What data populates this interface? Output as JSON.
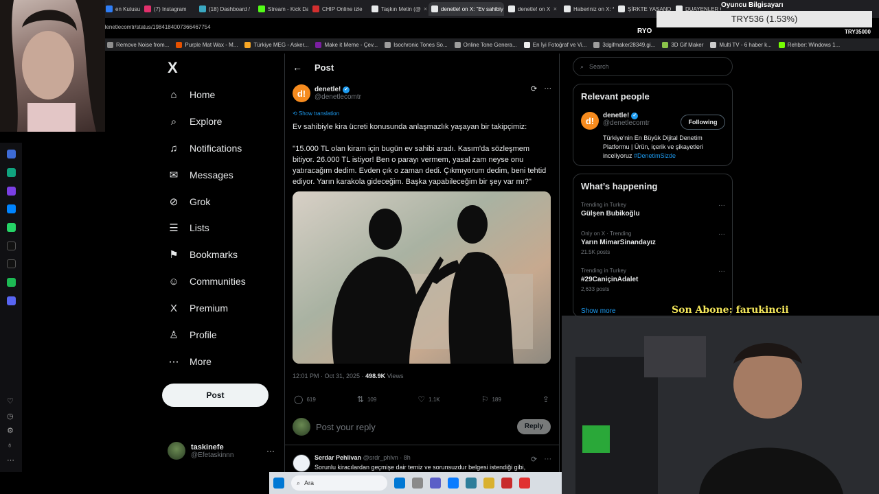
{
  "browser": {
    "tabs": [
      {
        "label": "en Kutusu (51",
        "color": "#2e7df6"
      },
      {
        "label": "(7) Instagram",
        "color": "#e1306c"
      },
      {
        "label": "(18) Dashboard /",
        "color": "#3aa8c1"
      },
      {
        "label": "Stream - Kick Da",
        "color": "#53fc18"
      },
      {
        "label": "CHIP Online izle",
        "color": "#d32f2f"
      },
      {
        "label": "Taşkın Metin (@",
        "color": "#e7e9ea"
      },
      {
        "label": "denetle! on X: \"Ev sahibiy",
        "color": "#e7e9ea"
      },
      {
        "label": "denetle! on X",
        "color": "#e7e9ea"
      },
      {
        "label": "Haberiniz on X: *",
        "color": "#e7e9ea"
      },
      {
        "label": "ŞİRKTE YASANDI",
        "color": "#e7e9ea"
      },
      {
        "label": "DUAYENLER Ca",
        "color": "#e7e9ea"
      }
    ],
    "url": "denetlecomtr/status/1984184007366467754",
    "bookmarks": [
      {
        "label": "Remove Noise from...",
        "color": "#8e8e8e"
      },
      {
        "label": "Purple Mat Wax - M...",
        "color": "#e65100"
      },
      {
        "label": "Türkiye MEG - Asker...",
        "color": "#f9a825"
      },
      {
        "label": "Make it Meme - Çev...",
        "color": "#7b1fa2"
      },
      {
        "label": "Isochronic Tones So...",
        "color": "#9e9e9e"
      },
      {
        "label": "Online Tone Genera...",
        "color": "#9e9e9e"
      },
      {
        "label": "En İyi Fotoğraf ve Vi...",
        "color": "#eeeeee"
      },
      {
        "label": "3dgifmaker28349.gi...",
        "color": "#9e9e9e"
      },
      {
        "label": "3D Gif Maker",
        "color": "#8bc34a"
      },
      {
        "label": "Multi TV - 6 haber k...",
        "color": "#cccccc"
      },
      {
        "label": "Rehber: Windows 1...",
        "color": "#76ff03"
      }
    ]
  },
  "overlay": {
    "ticker": "TRY536 (1.53%)",
    "oyuncu": "Oyuncu Bilgisayarı",
    "ryo": "RYO",
    "try_right": "TRY35000",
    "son_abone": "Son Abone: farukincii"
  },
  "nav": {
    "logo": "X",
    "items": [
      {
        "label": "Home",
        "icon": "⌂"
      },
      {
        "label": "Explore",
        "icon": "⌕"
      },
      {
        "label": "Notifications",
        "icon": "♫"
      },
      {
        "label": "Messages",
        "icon": "✉"
      },
      {
        "label": "Grok",
        "icon": "⊘"
      },
      {
        "label": "Lists",
        "icon": "☰"
      },
      {
        "label": "Bookmarks",
        "icon": "⚑"
      },
      {
        "label": "Communities",
        "icon": "☺"
      },
      {
        "label": "Premium",
        "icon": "X"
      },
      {
        "label": "Profile",
        "icon": "♙"
      },
      {
        "label": "More",
        "icon": "⋯"
      }
    ],
    "post_button": "Post",
    "account": {
      "name": "taskinefe",
      "handle": "@Efetaskinnn"
    }
  },
  "post": {
    "header": "Post",
    "author_name": "denetle!",
    "author_handle": "@denetlecomtr",
    "show_translation": "Show translation",
    "text1": "Ev sahibiyle kira ücreti konusunda anlaşmazlık yaşayan bir takipçimiz:",
    "text2": "''15.000 TL olan kiram için bugün ev sahibi aradı. Kasım'da sözleşmem bitiyor. 26.000 TL istiyor! Ben o parayı vermem, yasal zam neyse onu yatıracağım dedim. Evden çık o zaman dedi. Çıkmıyorum dedim, beni tehtid ediyor. Yarın karakola gideceğim. Başka yapabileceğim bir şey var mı?''",
    "time": "12:01 PM · Oct 31, 2025 · ",
    "views_count": "498.9K",
    "views_label": " Views",
    "replies": "619",
    "reposts": "109",
    "likes": "1.1K",
    "bookmarks": "189",
    "reply_placeholder": "Post your reply",
    "reply_button": "Reply"
  },
  "reply": {
    "name": "Serdar Pehlivan",
    "handle": "@srdr_phlvn · 8h",
    "text": "Sorunlu kiracılardan geçmişe dair temiz ve sorunsuzdur belgesi istendiği gibi,"
  },
  "right": {
    "search_placeholder": "Search",
    "relevant_title": "Relevant people",
    "person_name": "denetle!",
    "person_handle": "@denetlecomtr",
    "follow_label": "Following",
    "bio": "Türkiye'nin En Büyük Dijital Denetim Platformu | Ürün, içerik ve şikayetleri inceliyoruz ",
    "bio_tag": "#DenetimSizde",
    "happening_title": "What’s happening",
    "trends": [
      {
        "context": "Trending in Turkey",
        "title": "Gülşen Bubikoğlu",
        "count": ""
      },
      {
        "context": "Only on X · Trending",
        "title": "Yarın MimarSinandayız",
        "count": "21.5K posts"
      },
      {
        "context": "Trending in Turkey",
        "title": "#29CaniçinAdalet",
        "count": "2,633 posts"
      }
    ],
    "show_more": "Show more"
  },
  "taskbar": {
    "search_label": "Ara",
    "icons": [
      "#0078d4",
      "#8a8a8a",
      "#5b5fc7",
      "#0a7cff",
      "#2d7d9a",
      "#d9b12f",
      "#c82b2b",
      "#e03131"
    ]
  }
}
